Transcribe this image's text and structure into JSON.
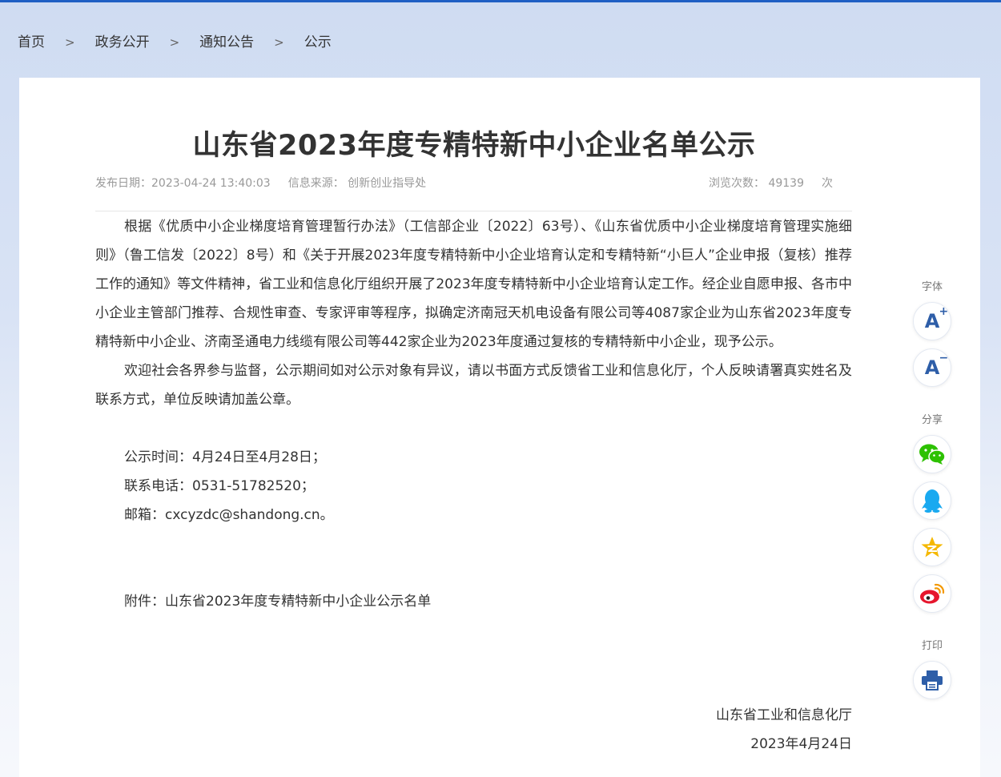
{
  "breadcrumb": [
    "首页",
    "政务公开",
    "通知公告",
    "公示"
  ],
  "breadcrumb_sep": ">",
  "article": {
    "title": "山东省2023年度专精特新中小企业名单公示",
    "publish_label": "发布日期：",
    "publish_date": "2023-04-24 13:40:03",
    "source_label": "信息来源：",
    "source": "创新创业指导处",
    "views_label": "浏览次数：",
    "views": "49139",
    "views_unit": "次",
    "paragraphs": [
      "根据《优质中小企业梯度培育管理暂行办法》（工信部企业〔2022〕63号）、《山东省优质中小企业梯度培育管理实施细则》（鲁工信发〔2022〕8号）和《关于开展2023年度专精特新中小企业培育认定和专精特新“小巨人”企业申报（复核）推荐工作的通知》等文件精神，省工业和信息化厅组织开展了2023年度专精特新中小企业培育认定工作。经企业自愿申报、各市中小企业主管部门推荐、合规性审查、专家评审等程序，拟确定济南冠天机电设备有限公司等4087家企业为山东省2023年度专精特新中小企业、济南圣通电力线缆有限公司等442家企业为2023年度通过复核的专精特新中小企业，现予公示。",
      "欢迎社会各界参与监督，公示期间如对公示对象有异议，请以书面方式反馈省工业和信息化厅，个人反映请署真实姓名及联系方式，单位反映请加盖公章。"
    ],
    "notice_time": "公示时间：4月24日至4月28日；",
    "phone": "联系电话：0531-51782520；",
    "email": "邮箱：cxcyzdc@shandong.cn。",
    "attachment_label": "附件：",
    "attachment": "山东省2023年度专精特新中小企业公示名单",
    "sign_org": "山东省工业和信息化厅",
    "sign_date": "2023年4月24日"
  },
  "tools": {
    "font_label": "字体",
    "share_label": "分享",
    "print_label": "打印",
    "font_increase_icon": "font-increase-icon",
    "font_decrease_icon": "font-decrease-icon",
    "share_icons": [
      "wechat-icon",
      "qq-icon",
      "qzone-icon",
      "weibo-icon"
    ],
    "print_icon": "printer-icon"
  },
  "colors": {
    "accent": "#2e5ea8",
    "wechat": "#2dc100",
    "qq": "#19a9f0",
    "qzone": "#f5b800",
    "weibo": "#e6162d"
  }
}
